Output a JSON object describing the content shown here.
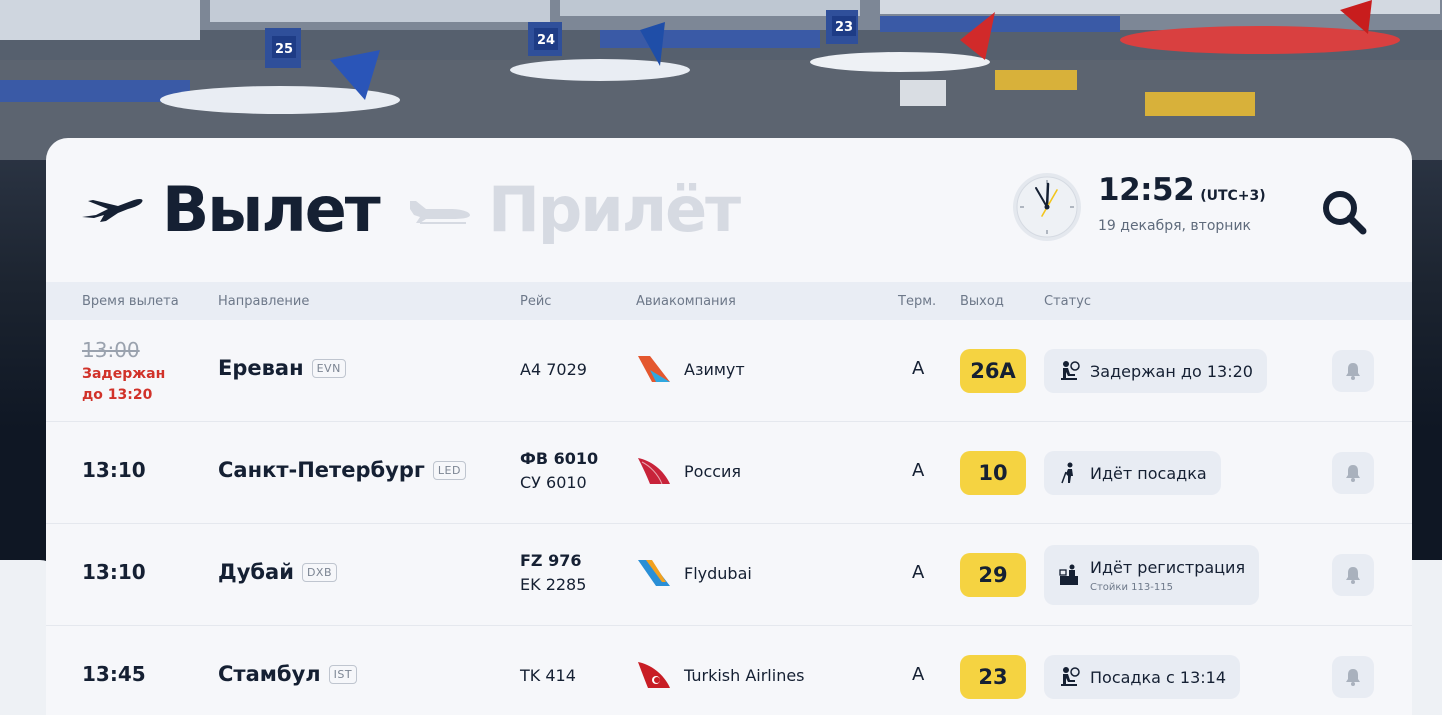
{
  "tabs": {
    "departure": "Вылет",
    "arrival": "Прилёт"
  },
  "clock": {
    "time": "12:52",
    "timezone": "(UTC+3)",
    "date": "19 декабря, вторник"
  },
  "icons": {
    "search": "search-icon",
    "bell": "bell-icon",
    "clock": "clock-icon",
    "departure_plane": "plane-takeoff-icon",
    "arrival_plane": "plane-landing-icon"
  },
  "colors": {
    "gate_badge": "#f5d341",
    "delay_text": "#d1322a",
    "primary_text": "#152033"
  },
  "table": {
    "headers": {
      "time": "Время вылета",
      "destination": "Направление",
      "flight": "Рейс",
      "airline": "Авиакомпания",
      "terminal": "Терм.",
      "gate": "Выход",
      "status": "Статус"
    },
    "rows": [
      {
        "time": "13:00",
        "delayed": true,
        "delay_note_1": "Задержан",
        "delay_note_2": "до 13:20",
        "city": "Ереван",
        "code": "EVN",
        "flight1": "A4 7029",
        "flight2": "",
        "airline": "Азимут",
        "terminal": "A",
        "gate": "26A",
        "status": "Задержан до 13:20",
        "status_sub": "",
        "status_icon": "waiting-passenger-icon"
      },
      {
        "time": "13:10",
        "delayed": false,
        "city": "Санкт-Петербург",
        "code": "LED",
        "flight1": "ФВ 6010",
        "flight2": "СУ 6010",
        "airline": "Россия",
        "terminal": "A",
        "gate": "10",
        "status": "Идёт посадка",
        "status_sub": "",
        "status_icon": "walking-passenger-icon"
      },
      {
        "time": "13:10",
        "delayed": false,
        "city": "Дубай",
        "code": "DXB",
        "flight1": "FZ 976",
        "flight2": "EK 2285",
        "airline": "Flydubai",
        "terminal": "A",
        "gate": "29",
        "status": "Идёт регистрация",
        "status_sub": "Стойки 113-115",
        "status_icon": "check-in-desk-icon"
      },
      {
        "time": "13:45",
        "delayed": false,
        "city": "Стамбул",
        "code": "IST",
        "flight1": "TK 414",
        "flight2": "",
        "airline": "Turkish Airlines",
        "terminal": "A",
        "gate": "23",
        "status": "Посадка с 13:14",
        "status_sub": "",
        "status_icon": "waiting-passenger-icon"
      }
    ]
  }
}
